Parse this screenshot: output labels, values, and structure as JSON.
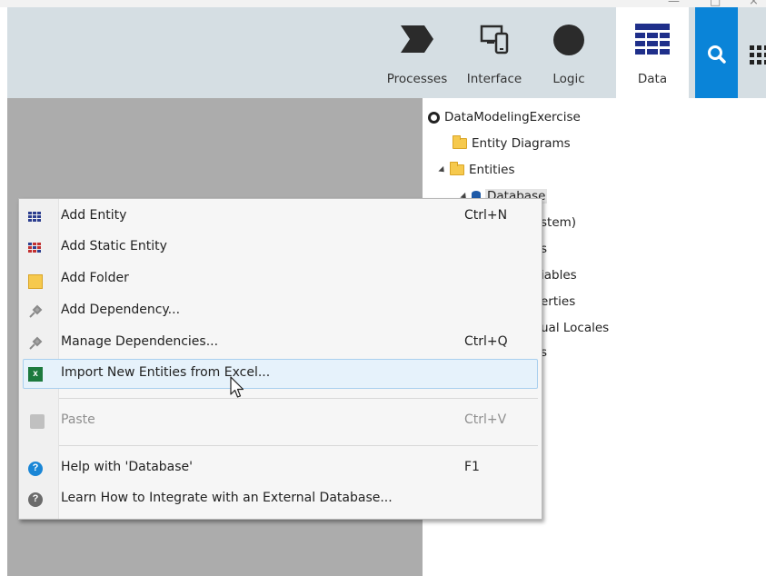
{
  "window": {
    "minimize": "—",
    "maximize": "□",
    "close": "×"
  },
  "toolbar": {
    "tabs": [
      {
        "label": "Processes",
        "icon": "processes-chevron-icon"
      },
      {
        "label": "Interface",
        "icon": "interface-devices-icon"
      },
      {
        "label": "Logic",
        "icon": "logic-circle-icon"
      },
      {
        "label": "Data",
        "icon": "data-grid-icon",
        "active": true
      }
    ],
    "search_icon": "search-icon",
    "apps_icon": "apps-grid-icon",
    "accent": "#0a84d8"
  },
  "tree": {
    "module": "DataModelingExercise",
    "items": [
      "Entity Diagrams",
      "Entities",
      "Database",
      "stem)",
      "s",
      "iables",
      "erties",
      "ual Locales",
      "s"
    ]
  },
  "context_menu": {
    "items": [
      {
        "label": "Add Entity",
        "shortcut": "Ctrl+N",
        "icon": "entity-grid-icon"
      },
      {
        "label": "Add Static Entity",
        "shortcut": "",
        "icon": "static-entity-grid-icon"
      },
      {
        "label": "Add Folder",
        "shortcut": "",
        "icon": "folder-icon"
      },
      {
        "label": "Add Dependency...",
        "shortcut": "",
        "icon": "plug-icon"
      },
      {
        "label": "Manage Dependencies...",
        "shortcut": "Ctrl+Q",
        "icon": "plug-icon"
      },
      {
        "label": "Import New Entities from Excel...",
        "shortcut": "",
        "icon": "excel-icon"
      },
      {
        "label": "Paste",
        "shortcut": "Ctrl+V",
        "icon": "paste-icon",
        "disabled": true
      },
      {
        "label": "Help with 'Database'",
        "shortcut": "F1",
        "icon": "help-icon"
      },
      {
        "label": "Learn How to Integrate with an External Database...",
        "shortcut": "",
        "icon": "question-icon"
      }
    ],
    "excel_glyph": "x",
    "help_glyph": "?"
  }
}
